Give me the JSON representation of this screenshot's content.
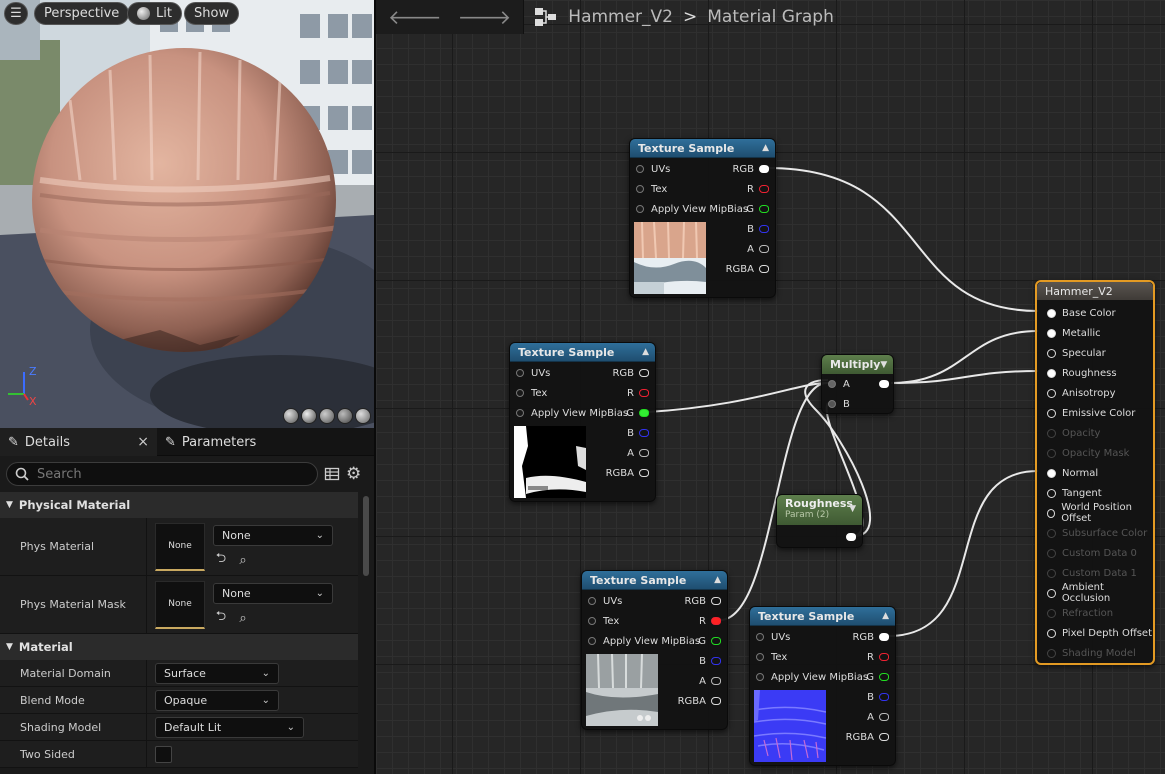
{
  "viewport": {
    "buttons": {
      "menu": "☰",
      "perspective": "Perspective",
      "lit": "Lit",
      "show": "Show"
    },
    "gizmo": {
      "z": "Z",
      "x": "X"
    }
  },
  "details": {
    "tabs": {
      "details": "Details",
      "parameters": "Parameters",
      "close": "×"
    },
    "search": {
      "placeholder": "Search"
    },
    "sections": {
      "physical_material": {
        "title": "Physical Material",
        "rows": [
          {
            "name": "Phys Material",
            "thumb": "None",
            "value": "None"
          },
          {
            "name": "Phys Material Mask",
            "thumb": "None",
            "value": "None"
          }
        ]
      },
      "material": {
        "title": "Material",
        "rows": [
          {
            "name": "Material Domain",
            "value": "Surface"
          },
          {
            "name": "Blend Mode",
            "value": "Opaque"
          },
          {
            "name": "Shading Model",
            "value": "Default Lit"
          },
          {
            "name": "Two Sided",
            "value": ""
          }
        ]
      }
    }
  },
  "graph": {
    "breadcrumb": {
      "asset": "Hammer_V2",
      "separator": ">",
      "page": "Material Graph"
    },
    "nodes": {
      "tex1": {
        "title": "Texture Sample",
        "inputs": [
          "UVs",
          "Tex",
          "Apply View MipBias"
        ],
        "outputs": [
          "RGB",
          "R",
          "G",
          "B",
          "A",
          "RGBA"
        ]
      },
      "tex2": {
        "title": "Texture Sample",
        "inputs": [
          "UVs",
          "Tex",
          "Apply View MipBias"
        ],
        "outputs": [
          "RGB",
          "R",
          "G",
          "B",
          "A",
          "RGBA"
        ]
      },
      "tex3": {
        "title": "Texture Sample",
        "inputs": [
          "UVs",
          "Tex",
          "Apply View MipBias"
        ],
        "outputs": [
          "RGB",
          "R",
          "G",
          "B",
          "A",
          "RGBA"
        ]
      },
      "tex4": {
        "title": "Texture Sample",
        "inputs": [
          "UVs",
          "Tex",
          "Apply View MipBias"
        ],
        "outputs": [
          "RGB",
          "R",
          "G",
          "B",
          "A",
          "RGBA"
        ]
      },
      "multiply": {
        "title": "Multiply",
        "inputs": [
          "A",
          "B"
        ]
      },
      "roughness": {
        "title": "Roughness",
        "subtitle": "Param (2)"
      },
      "output": {
        "title": "Hammer_V2",
        "inputs": [
          {
            "label": "Base Color",
            "enabled": true,
            "connected": true
          },
          {
            "label": "Metallic",
            "enabled": true,
            "connected": true
          },
          {
            "label": "Specular",
            "enabled": true,
            "connected": false
          },
          {
            "label": "Roughness",
            "enabled": true,
            "connected": true
          },
          {
            "label": "Anisotropy",
            "enabled": true,
            "connected": false
          },
          {
            "label": "Emissive Color",
            "enabled": true,
            "connected": false
          },
          {
            "label": "Opacity",
            "enabled": false,
            "connected": false
          },
          {
            "label": "Opacity Mask",
            "enabled": false,
            "connected": false
          },
          {
            "label": "Normal",
            "enabled": true,
            "connected": true
          },
          {
            "label": "Tangent",
            "enabled": true,
            "connected": false
          },
          {
            "label": "World Position Offset",
            "enabled": true,
            "connected": false
          },
          {
            "label": "Subsurface Color",
            "enabled": false,
            "connected": false
          },
          {
            "label": "Custom Data 0",
            "enabled": false,
            "connected": false
          },
          {
            "label": "Custom Data 1",
            "enabled": false,
            "connected": false
          },
          {
            "label": "Ambient Occlusion",
            "enabled": true,
            "connected": false
          },
          {
            "label": "Refraction",
            "enabled": false,
            "connected": false
          },
          {
            "label": "Pixel Depth Offset",
            "enabled": true,
            "connected": false
          },
          {
            "label": "Shading Model",
            "enabled": false,
            "connected": false
          }
        ]
      }
    },
    "colors": {
      "output_border": "#e39a23",
      "texture_header": "#2f6f9a",
      "param_header": "#5e7f4c"
    }
  }
}
